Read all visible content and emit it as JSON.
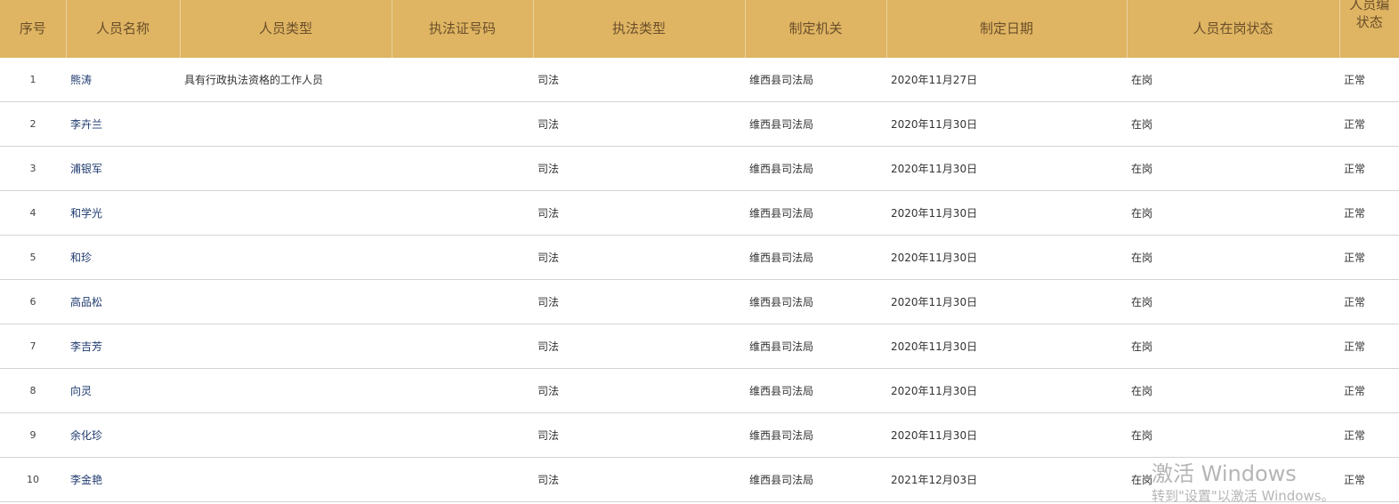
{
  "table": {
    "headers": [
      "序号",
      "人员名称",
      "人员类型",
      "执法证号码",
      "执法类型",
      "制定机关",
      "制定日期",
      "人员在岗状态"
    ],
    "last_header_line1": "人员编",
    "last_header_line2": "状态",
    "rows": [
      {
        "idx": "1",
        "name": "熊涛",
        "type": "具有行政执法资格的工作人员",
        "cert": "",
        "law_type": "司法",
        "org": "维西县司法局",
        "date": "2020年11月27日",
        "duty": "在岗",
        "status": "正常"
      },
      {
        "idx": "2",
        "name": "李卉兰",
        "type": "",
        "cert": "",
        "law_type": "司法",
        "org": "维西县司法局",
        "date": "2020年11月30日",
        "duty": "在岗",
        "status": "正常"
      },
      {
        "idx": "3",
        "name": "浦银军",
        "type": "",
        "cert": "",
        "law_type": "司法",
        "org": "维西县司法局",
        "date": "2020年11月30日",
        "duty": "在岗",
        "status": "正常"
      },
      {
        "idx": "4",
        "name": "和学光",
        "type": "",
        "cert": "",
        "law_type": "司法",
        "org": "维西县司法局",
        "date": "2020年11月30日",
        "duty": "在岗",
        "status": "正常"
      },
      {
        "idx": "5",
        "name": "和珍",
        "type": "",
        "cert": "",
        "law_type": "司法",
        "org": "维西县司法局",
        "date": "2020年11月30日",
        "duty": "在岗",
        "status": "正常"
      },
      {
        "idx": "6",
        "name": "高品松",
        "type": "",
        "cert": "",
        "law_type": "司法",
        "org": "维西县司法局",
        "date": "2020年11月30日",
        "duty": "在岗",
        "status": "正常"
      },
      {
        "idx": "7",
        "name": "李吉芳",
        "type": "",
        "cert": "",
        "law_type": "司法",
        "org": "维西县司法局",
        "date": "2020年11月30日",
        "duty": "在岗",
        "status": "正常"
      },
      {
        "idx": "8",
        "name": "向灵",
        "type": "",
        "cert": "",
        "law_type": "司法",
        "org": "维西县司法局",
        "date": "2020年11月30日",
        "duty": "在岗",
        "status": "正常"
      },
      {
        "idx": "9",
        "name": "余化珍",
        "type": "",
        "cert": "",
        "law_type": "司法",
        "org": "维西县司法局",
        "date": "2020年11月30日",
        "duty": "在岗",
        "status": "正常"
      },
      {
        "idx": "10",
        "name": "李金艳",
        "type": "",
        "cert": "",
        "law_type": "司法",
        "org": "维西县司法局",
        "date": "2021年12月03日",
        "duty": "在岗",
        "status": "正常"
      }
    ]
  },
  "watermark": {
    "line1": "激活 Windows",
    "line2": "转到\"设置\"以激活 Windows。"
  },
  "colors": {
    "header_bg": "#dfb563",
    "header_text": "#6b4e2a",
    "name_link": "#1f3a6e"
  }
}
